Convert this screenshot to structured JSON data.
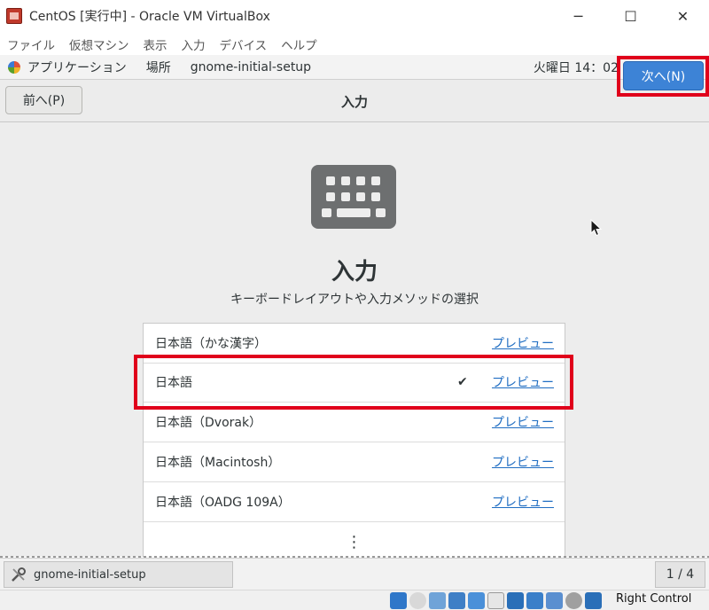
{
  "window": {
    "title": "CentOS [実行中] - Oracle VM VirtualBox",
    "minimize": "─",
    "maximize": "☐",
    "close": "✕"
  },
  "menubar": [
    "ファイル",
    "仮想マシン",
    "表示",
    "入力",
    "デバイス",
    "ヘルプ"
  ],
  "top_panel": {
    "applications": "アプリケーション",
    "places": "場所",
    "app_name": "gnome-initial-setup",
    "clock": "火曜日 14：02"
  },
  "header": {
    "prev_label": "前へ(P)",
    "title": "入力",
    "next_label": "次へ(N)"
  },
  "page": {
    "heading": "入力",
    "subtitle": "キーボードレイアウトや入力メソッドの選択"
  },
  "input_sources": [
    {
      "label": "日本語（かな漢字）",
      "preview": "プレビュー",
      "check": ""
    },
    {
      "label": "日本語",
      "preview": "プレビュー",
      "check": "✔"
    },
    {
      "label": "日本語（Dvorak）",
      "preview": "プレビュー",
      "check": ""
    },
    {
      "label": "日本語（Macintosh）",
      "preview": "プレビュー",
      "check": ""
    },
    {
      "label": "日本語（OADG 109A）",
      "preview": "プレビュー",
      "check": ""
    }
  ],
  "more_symbol": "⋮",
  "taskbar": {
    "task_label": "gnome-initial-setup",
    "workspace": "1 / 4"
  },
  "statusbar": {
    "host_key": "Right Control"
  },
  "colors": {
    "next_button": "#3d83d6",
    "highlight_outline": "#e0001b",
    "link": "#1f6dc2"
  }
}
